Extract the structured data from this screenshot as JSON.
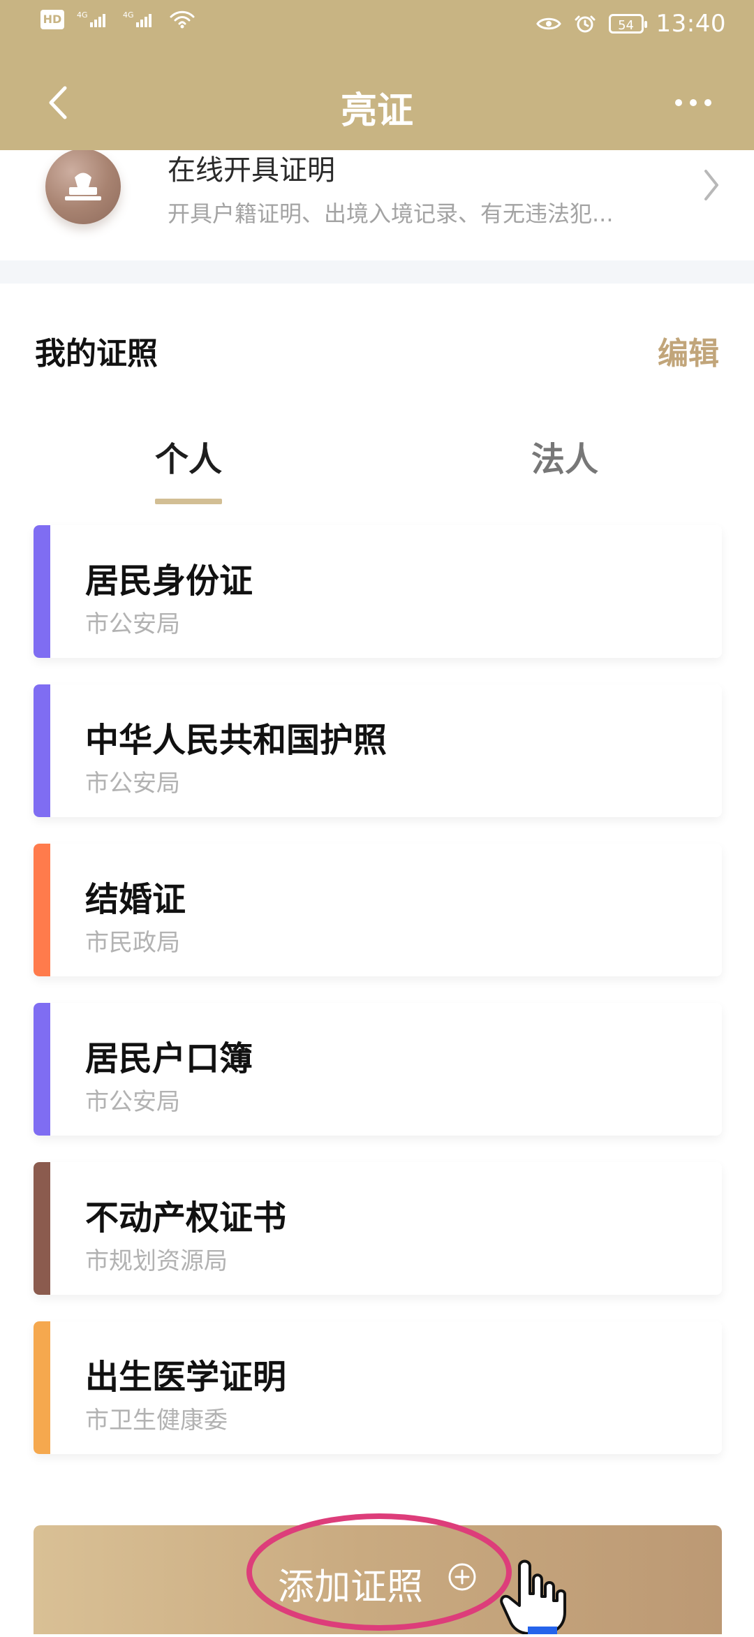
{
  "status_bar": {
    "network_hd": "HD",
    "signal_1": "4G",
    "signal_2": "4G",
    "battery": "54",
    "time": "13:40"
  },
  "header": {
    "title": "亮证"
  },
  "service": {
    "title": "在线开具证明",
    "subtitle": "开具户籍证明、出境入境记录、有无违法犯..."
  },
  "main": {
    "section_title": "我的证照",
    "edit_label": "编辑",
    "tabs": [
      {
        "label": "个人",
        "selected": true
      },
      {
        "label": "法人",
        "selected": false
      }
    ],
    "certificates": [
      {
        "name": "居民身份证",
        "org": "市公安局",
        "color": "#7f6df2"
      },
      {
        "name": "中华人民共和国护照",
        "org": "市公安局",
        "color": "#7f6df2"
      },
      {
        "name": "结婚证",
        "org": "市民政局",
        "color": "#ff7b4c"
      },
      {
        "name": "居民户口簿",
        "org": "市公安局",
        "color": "#7f6df2"
      },
      {
        "name": "不动产权证书",
        "org": "市规划资源局",
        "color": "#8b5b4e"
      },
      {
        "name": "出生医学证明",
        "org": "市卫生健康委",
        "color": "#f5a84e"
      }
    ]
  },
  "footer": {
    "add_label": "添加证照"
  },
  "colors": {
    "header_bg": "#c8b483",
    "accent": "#c1a57a",
    "tab_indicator": "#d2be94",
    "highlight_ring": "#dd3d7a"
  },
  "icons": {
    "back": "chevron-left-icon",
    "more": "more-dots-icon",
    "service": "stamp-icon",
    "service_arrow": "chevron-right-icon",
    "add": "plus-circle-icon",
    "pointer": "hand-pointer-icon"
  }
}
